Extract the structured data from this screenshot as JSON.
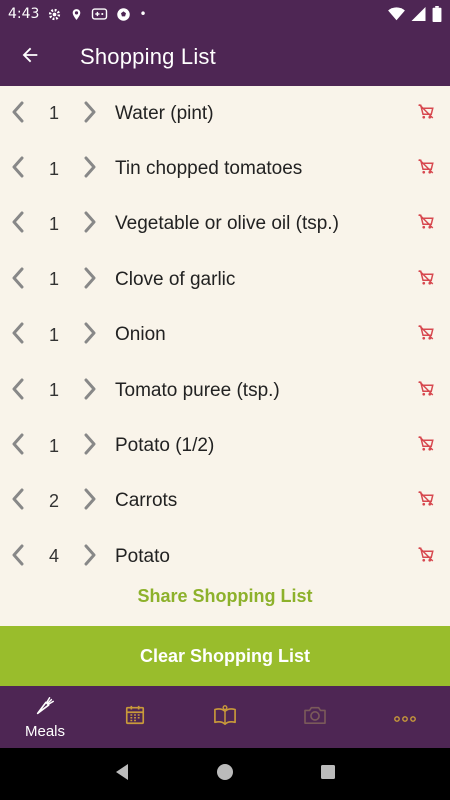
{
  "status_bar": {
    "time": "4:43",
    "dot": "•"
  },
  "app_bar": {
    "title": "Shopping List"
  },
  "items": [
    {
      "qty": "1",
      "name": "Water (pint)"
    },
    {
      "qty": "1",
      "name": "Tin chopped tomatoes"
    },
    {
      "qty": "1",
      "name": "Vegetable or olive oil (tsp.)"
    },
    {
      "qty": "1",
      "name": "Clove of garlic"
    },
    {
      "qty": "1",
      "name": "Onion"
    },
    {
      "qty": "1",
      "name": "Tomato puree (tsp.)"
    },
    {
      "qty": "1",
      "name": "Potato (1/2)"
    },
    {
      "qty": "2",
      "name": "Carrots"
    },
    {
      "qty": "4",
      "name": "Potato"
    }
  ],
  "actions": {
    "share": "Share Shopping List",
    "clear": "Clear Shopping List"
  },
  "bottom_nav": {
    "meals_label": "Meals"
  },
  "colors": {
    "primary": "#4e2654",
    "accent_green": "#99bd2c",
    "share_text": "#8db12b",
    "remove_icon": "#d7484f",
    "nav_icon": "#c99a3a",
    "background": "#f9f4ea"
  },
  "icons": {
    "back": "arrow-left-icon",
    "decrement": "chevron-left-icon",
    "increment": "chevron-right-icon",
    "remove": "remove-from-cart-icon",
    "meals": "carrot-icon",
    "planner": "calendar-icon",
    "recipes": "book-icon",
    "camera": "camera-icon",
    "more": "more-icon"
  }
}
